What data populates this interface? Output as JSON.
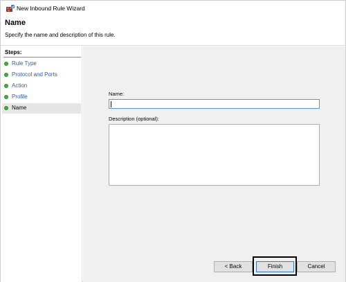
{
  "window": {
    "title": "New Inbound Rule Wizard",
    "icon": "firewall-wizard-icon"
  },
  "header": {
    "title": "Name",
    "description": "Specify the name and description of this rule."
  },
  "steps": {
    "heading": "Steps:",
    "items": [
      {
        "label": "Rule Type",
        "state": "completed"
      },
      {
        "label": "Protocol and Ports",
        "state": "completed"
      },
      {
        "label": "Action",
        "state": "completed"
      },
      {
        "label": "Profile",
        "state": "completed"
      },
      {
        "label": "Name",
        "state": "current"
      }
    ],
    "dot_color": "#3fae3f"
  },
  "form": {
    "name_label": "Name:",
    "name_value": "",
    "description_label": "Description (optional):",
    "description_value": ""
  },
  "buttons": {
    "back_label": "< Back",
    "finish_label": "Finish",
    "cancel_label": "Cancel"
  },
  "colors": {
    "link": "#2a62b8",
    "accent_border": "#5b93d6",
    "content_bg": "#f0f0f0"
  }
}
